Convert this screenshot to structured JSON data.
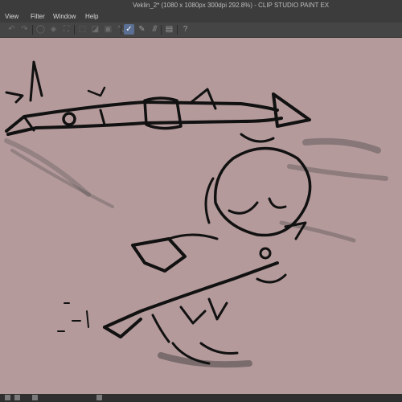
{
  "window": {
    "title": "Veklin_2* (1080 x 1080px 300dpi 292.8%)  -  CLIP STUDIO PAINT EX"
  },
  "menu": {
    "view": "View",
    "filter": "Filter",
    "window": "Window",
    "help": "Help"
  },
  "toolbar": {
    "icons": [
      "undo-icon",
      "redo-icon",
      "clear-icon",
      "fill-icon",
      "transform-icon",
      "deselect-icon",
      "invert-selection-icon",
      "select-all-icon",
      "crop-icon",
      "brush-mode-icon",
      "vector-pen-icon",
      "hatch-icon",
      "stamp-icon",
      "help-icon"
    ],
    "glyphs": {
      "undo": "↶",
      "redo": "↷",
      "clear": "◯",
      "fill": "◈",
      "transform": "⛶",
      "deselect": "⬚",
      "invert": "◪",
      "select_all": "▣",
      "crop": "⤡",
      "brush_mode": "✓",
      "vector_pen": "✎",
      "hatch": "⫻",
      "stamp": "▤",
      "help": "?"
    },
    "active_color": "#5a6f93"
  },
  "canvas": {
    "background": "#b59a9b",
    "stroke_color": "#111111"
  }
}
